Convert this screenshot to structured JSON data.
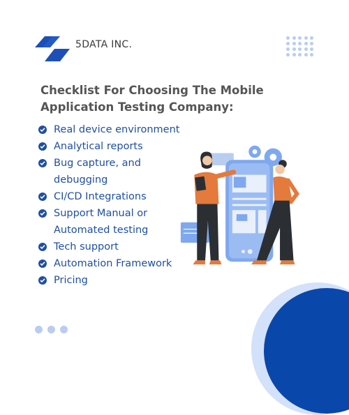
{
  "brand": {
    "name": "5DATA INC.",
    "logo_icon": "stacked-parallelograms-logo",
    "color": "#1d4fb8"
  },
  "title": {
    "line1": "Checklist For Choosing The Mobile",
    "line2": "Application Testing Company:"
  },
  "checklist": {
    "icon": "check-circle-icon",
    "items": [
      "Real device environment",
      "Analytical reports",
      "Bug capture, and debugging",
      "CI/CD Integrations",
      "Support Manual or Automated testing",
      "Tech support",
      "Automation Framework",
      "Pricing"
    ]
  },
  "illustration": {
    "description": "two-people-presenting-mobile-app",
    "colors": {
      "phone": "#7fa8ef",
      "shirt": "#e47a3c",
      "pants": "#2b2f33"
    }
  },
  "decor": {
    "dot_grid_color": "#b8cdf0",
    "circle_outer": "#d3e1fa",
    "circle_inner": "#0a47ab"
  }
}
